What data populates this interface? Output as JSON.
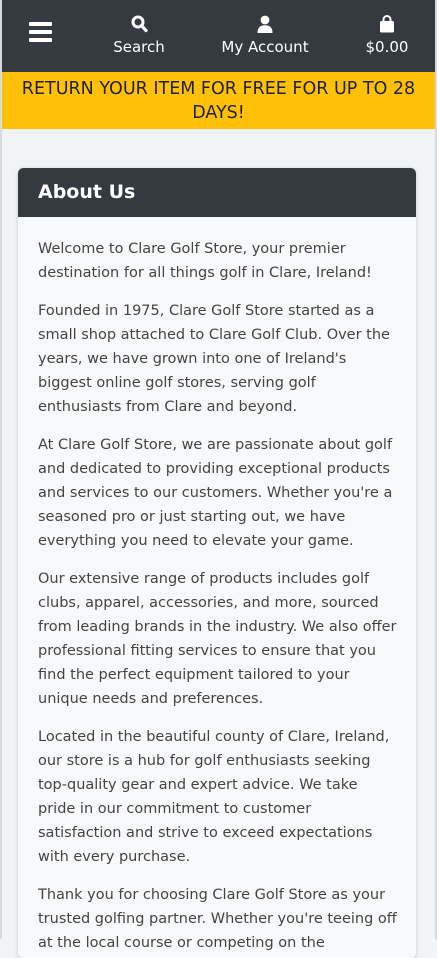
{
  "header": {
    "menu_icon": "hamburger-menu-icon",
    "search": {
      "icon": "search-icon",
      "label": "Search"
    },
    "account": {
      "icon": "user-icon",
      "label": "My Account"
    },
    "cart": {
      "icon": "shopping-bag-icon",
      "label": "$0.00"
    },
    "background_color": "#343a40"
  },
  "promo": {
    "text": "RETURN YOUR ITEM FOR FREE FOR UP TO 28 DAYS!",
    "background_color": "#ffc107"
  },
  "about": {
    "title": "About Us",
    "paragraphs": [
      "Welcome to Clare Golf Store, your premier destination for all things golf in Clare, Ireland!",
      "Founded in 1975, Clare Golf Store started as a small shop attached to Clare Golf Club. Over the years, we have grown into one of Ireland's biggest online golf stores, serving golf enthusiasts from Clare and beyond.",
      "At Clare Golf Store, we are passionate about golf and dedicated to providing exceptional products and services to our customers. Whether you're a seasoned pro or just starting out, we have everything you need to elevate your game.",
      "Our extensive range of products includes golf clubs, apparel, accessories, and more, sourced from leading brands in the industry. We also offer professional fitting services to ensure that you find the perfect equipment tailored to your unique needs and preferences.",
      "Located in the beautiful county of Clare, Ireland, our store is a hub for golf enthusiasts seeking top-quality gear and expert advice. We take pride in our commitment to customer satisfaction and strive to exceed expectations with every purchase.",
      "Thank you for choosing Clare Golf Store as your trusted golfing partner. Whether you're teeing off at the local course or competing on the"
    ]
  }
}
